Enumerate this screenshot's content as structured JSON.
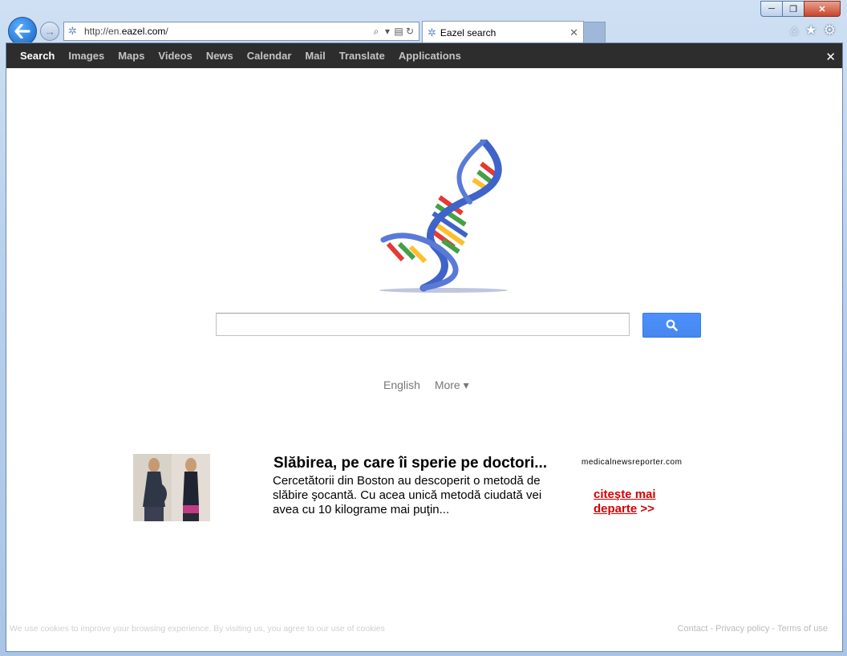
{
  "browser": {
    "window_controls": {
      "minimize": "─",
      "maximize": "❐",
      "close": "✕"
    },
    "back_glyph": "🡐",
    "forward_glyph": "→",
    "address": {
      "url_prefix": "http://en.",
      "url_domain": "eazel.com",
      "url_suffix": "/"
    },
    "tab": {
      "title": "Eazel search",
      "close": "✕"
    },
    "toolbar_icons": [
      "home-icon",
      "favorites-icon",
      "tools-icon"
    ]
  },
  "gbar": {
    "items": [
      "Search",
      "Images",
      "Maps",
      "Videos",
      "News",
      "Calendar",
      "Mail",
      "Translate",
      "Applications"
    ],
    "active": "Search"
  },
  "search": {
    "value": "",
    "placeholder": ""
  },
  "language": {
    "current": "English",
    "more": "More ▾"
  },
  "ad": {
    "title": "Slăbirea, pe care îi sperie pe doctori...",
    "body": "Cercetătorii din Boston au descoperit o metodă de slăbire şocantă. Cu acea unică metodă ciudată vei avea cu 10 kilograme mai puţin...",
    "source": "medicalnewsreporter.com",
    "link_text": "citeşte mai departe",
    "link_suffix": " >>"
  },
  "cookie_notice": "We use cookies to improve your browsing experience. By visiting us, you agree to our use of cookies",
  "footer": {
    "contact": "Contact",
    "privacy": "Privacy policy",
    "terms": "Terms of use",
    "separator": "-"
  },
  "colors": {
    "gbar_bg": "#2d2d2d",
    "search_button": "#4d90fe",
    "ad_link": "#d50000"
  }
}
